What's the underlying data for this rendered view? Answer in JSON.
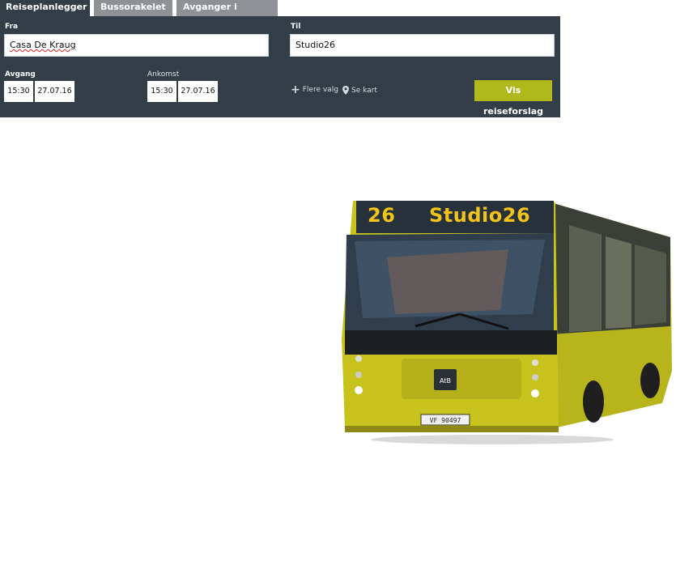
{
  "tabs": [
    {
      "label": "Reiseplanlegger",
      "active": true
    },
    {
      "label": "Bussorakelet",
      "active": false
    },
    {
      "label": "Avganger i sanntid",
      "active": false
    }
  ],
  "form": {
    "from_label": "Fra",
    "from_value": "Casa De Kraug",
    "to_label": "Til",
    "to_value": "Studio26",
    "departure_label": "Avgang",
    "departure_time": "15:30",
    "departure_date": "27.07.16",
    "arrival_label": "Ankomst",
    "arrival_time": "15:30",
    "arrival_date": "27.07.16",
    "more_options": "Flere valg",
    "see_map": "Se kart",
    "submit": "Vis reiseforslag"
  },
  "bus": {
    "route_number": "26",
    "destination": "Studio26",
    "plate": "VF 90497",
    "logo_text": "AtB",
    "body_color": "#c9c21d",
    "sign_color": "#f2c318"
  },
  "colors": {
    "panel": "#333d47",
    "inactive_tab": "#8e9195",
    "accent": "#b0b91c"
  }
}
